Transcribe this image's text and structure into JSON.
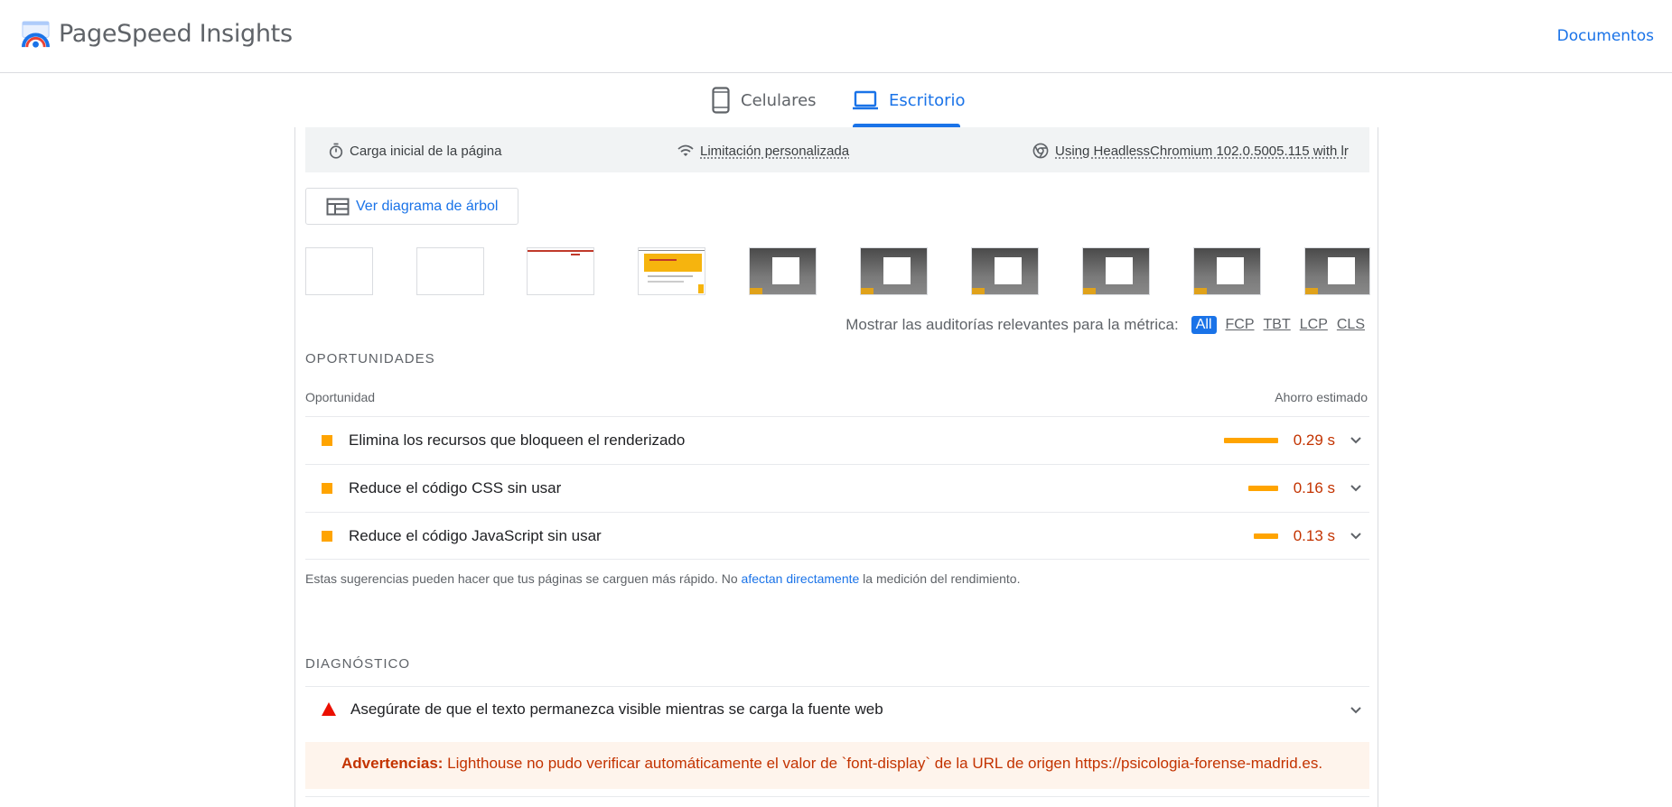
{
  "header": {
    "brand": "PageSpeed Insights",
    "docs_link": "Documentos"
  },
  "tabs": [
    {
      "label": "Celulares",
      "icon": "smartphone-icon",
      "selected": false
    },
    {
      "label": "Escritorio",
      "icon": "laptop-icon",
      "selected": true
    }
  ],
  "meta": {
    "items": [
      {
        "label": "Carga inicial de la página",
        "icon": "timer-icon"
      },
      {
        "label": "Limitación personalizada",
        "icon": "wifi-icon"
      },
      {
        "label": "Using HeadlessChromium 102.0.5005.115 with lr",
        "icon": "chrome-icon"
      }
    ]
  },
  "tree_button": {
    "label": "Ver diagrama de árbol",
    "icon": "treemap-icon"
  },
  "metric_filter": {
    "label": "Mostrar las auditorías relevantes para la métrica:",
    "chips": [
      "All",
      "FCP",
      "TBT",
      "LCP",
      "CLS"
    ],
    "active": "All"
  },
  "opportunities": {
    "section_title": "OPORTUNIDADES",
    "col_left": "Oportunidad",
    "col_right": "Ahorro estimado",
    "rows": [
      {
        "title": "Elimina los recursos que bloqueen el renderizado",
        "savings": "0.29 s",
        "savings_seconds": 0.29
      },
      {
        "title": "Reduce el código CSS sin usar",
        "savings": "0.16 s",
        "savings_seconds": 0.16
      },
      {
        "title": "Reduce el código JavaScript sin usar",
        "savings": "0.13 s",
        "savings_seconds": 0.13
      }
    ],
    "hint_pre": "Estas sugerencias pueden hacer que tus páginas se carguen más rápido. No ",
    "hint_link": "afectan directamente",
    "hint_post": " la medición del rendimiento."
  },
  "diagnostics": {
    "section_title": "DIAGNÓSTICO",
    "row_title": "Asegúrate de que el texto permanezca visible mientras se carga la fuente web",
    "warning_label": "Advertencias:",
    "warning_text": " Lighthouse no pudo verificar automáticamente el valor de `font-display` de la URL de origen https://psicologia-forense-madrid.es."
  },
  "colors": {
    "accent": "#1a73e8",
    "average": "#ffa400",
    "fail": "#c33300",
    "fail_icon": "#eb0f00"
  }
}
